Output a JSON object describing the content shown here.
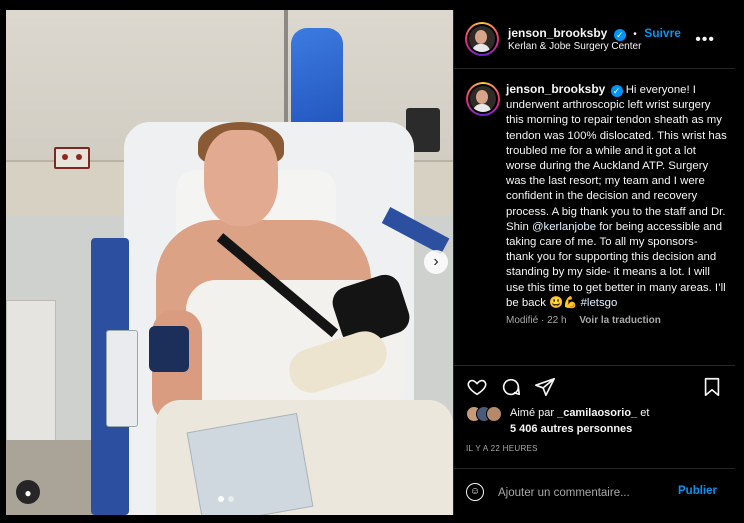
{
  "post": {
    "username": "jenson_brooksby",
    "verified_mark": "✓",
    "separator": "•",
    "follow_label": "Suivre",
    "location": "Kerlan & Jobe Surgery Center",
    "more_label": "•••"
  },
  "caption": {
    "username": "jenson_brooksby",
    "text_before_mention": "Hi everyone! I underwent arthroscopic left wrist surgery this morning to repair tendon sheath as my tendon was 100% dislocated. This wrist has troubled me for a while and it got a lot worse during the Auckland ATP. Surgery was the last resort; my team and I were confident in the decision and recovery process. A big thank you to the staff and Dr. Shin ",
    "mention": "@kerlanjobe",
    "text_after_mention": " for being accessible and taking care of me. To all my sponsors- thank you for supporting this decision and standing by my side- it means a lot. I will use this time to get better in many areas. I’ll be back 😃💪 ",
    "hashtag": "#letsgo",
    "edited": "Modifié · 22 h",
    "translate": "Voir la traduction"
  },
  "actions": {
    "like_icon": "heart-icon",
    "comment_icon": "comment-icon",
    "share_icon": "send-icon",
    "save_icon": "bookmark-icon"
  },
  "likes": {
    "prefix": "Aimé par ",
    "user": "_camilaosorio_",
    "suffix": " et",
    "others": "5 406 autres personnes"
  },
  "time": "IL Y A 22 HEURES",
  "comment": {
    "placeholder": "Ajouter un commentaire...",
    "publish_label": "Publier"
  },
  "colors": {
    "accent": "#0095f6",
    "background": "#000000",
    "secondary_text": "#a8a8a8"
  }
}
